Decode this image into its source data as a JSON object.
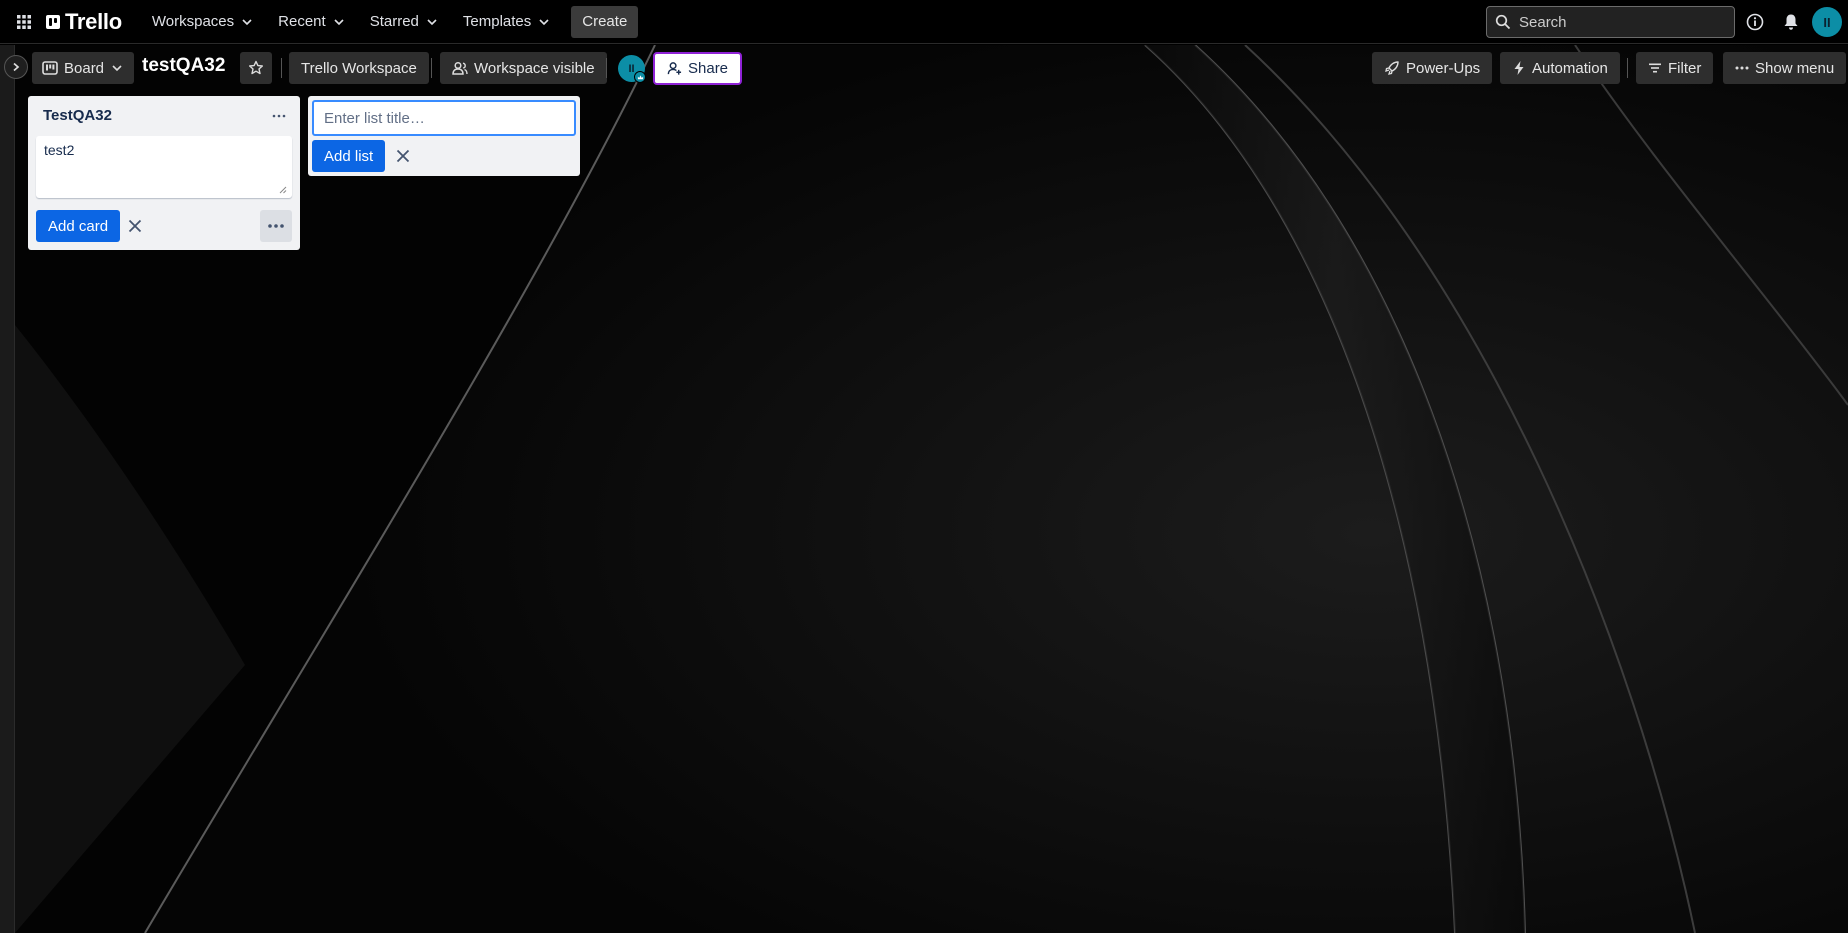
{
  "topnav": {
    "logo": "Trello",
    "menus": [
      "Workspaces",
      "Recent",
      "Starred",
      "Templates"
    ],
    "create": "Create",
    "search_placeholder": "Search",
    "avatar_initials": "II"
  },
  "board": {
    "view": "Board",
    "title": "testQA32",
    "workspace": "Trello Workspace",
    "visibility": "Workspace visible",
    "member_initials": "II",
    "share": "Share",
    "powerups": "Power-Ups",
    "automation": "Automation",
    "filter": "Filter",
    "show_menu": "Show menu"
  },
  "lists": [
    {
      "title": "TestQA32",
      "composer_text": "test2",
      "add_card_label": "Add card"
    }
  ],
  "add_list": {
    "placeholder": "Enter list title…",
    "button": "Add list"
  },
  "colors": {
    "primary": "#0c66e4",
    "avatar": "#0c8ea6",
    "share_border": "#8f22d6",
    "list_bg": "#f1f2f4"
  }
}
